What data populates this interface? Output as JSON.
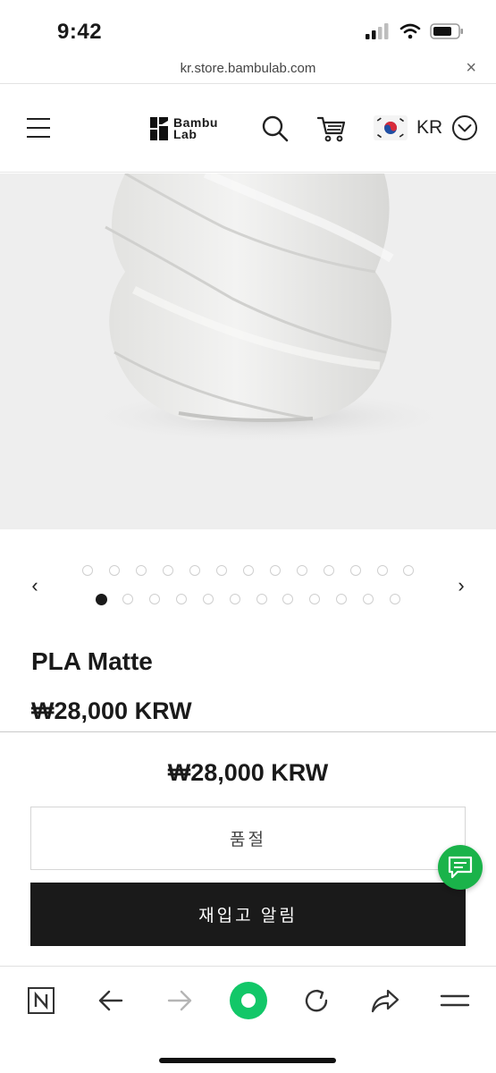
{
  "status_bar": {
    "time": "9:42"
  },
  "url_bar": {
    "url": "kr.store.bambulab.com",
    "close_glyph": "×"
  },
  "header": {
    "logo_line1": "Bambu",
    "logo_line2": "Lab",
    "region_code": "KR",
    "icons": [
      "menu-icon",
      "search-icon",
      "cart-icon",
      "kr-flag-icon",
      "chevron-down-icon"
    ]
  },
  "carousel": {
    "prev_glyph": "‹",
    "next_glyph": "›",
    "active_index": 0
  },
  "product": {
    "title": "PLA Matte",
    "price": "₩28,000 KRW"
  },
  "sticky": {
    "price": "₩28,000 KRW",
    "soldout_label": "품절",
    "notify_label": "재입고 알림"
  },
  "toolbar": {
    "icons": [
      "naver-icon",
      "back-icon",
      "forward-icon",
      "home-green-icon",
      "reload-icon",
      "share-icon",
      "menu-lines-icon"
    ]
  },
  "colors": {
    "accent_green": "#1ab34a",
    "dark": "#1a1a1a",
    "hero_bg": "#eeeeee"
  }
}
